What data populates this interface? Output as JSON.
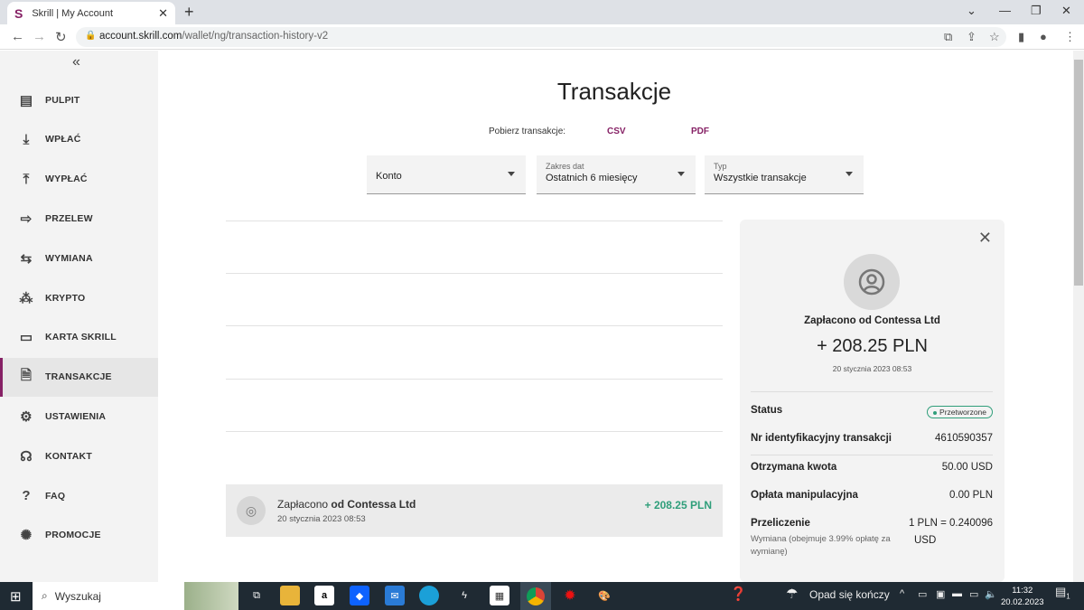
{
  "browser": {
    "tab_title": "Skrill | My Account",
    "tab_logo": "S",
    "url_host": "account.skrill.com",
    "url_path": "/wallet/ng/transaction-history-v2"
  },
  "colors": {
    "brand": "#862165",
    "positive": "#2f9e7a"
  },
  "sidebar": {
    "items": [
      {
        "label": "PULPIT",
        "icon": "dashboard-icon"
      },
      {
        "label": "WPŁAĆ",
        "icon": "deposit-icon"
      },
      {
        "label": "WYPŁAĆ",
        "icon": "withdraw-icon"
      },
      {
        "label": "PRZELEW",
        "icon": "transfer-icon"
      },
      {
        "label": "WYMIANA",
        "icon": "exchange-icon"
      },
      {
        "label": "KRYPTO",
        "icon": "crypto-icon"
      },
      {
        "label": "KARTA SKRILL",
        "icon": "card-icon"
      },
      {
        "label": "TRANSAKCJE",
        "icon": "document-icon",
        "active": true
      },
      {
        "label": "USTAWIENIA",
        "icon": "gear-icon"
      },
      {
        "label": "KONTAKT",
        "icon": "headset-icon"
      },
      {
        "label": "FAQ",
        "icon": "question-icon"
      },
      {
        "label": "PROMOCJE",
        "icon": "promo-icon"
      }
    ]
  },
  "main": {
    "title": "Transakcje",
    "download_label": "Pobierz transakcje:",
    "csv": "CSV",
    "pdf": "PDF",
    "filters": [
      {
        "label": "",
        "value": "Konto"
      },
      {
        "label": "Zakres dat",
        "value": "Ostatnich 6 miesięcy"
      },
      {
        "label": "Typ",
        "value": "Wszystkie transakcje"
      }
    ],
    "transaction": {
      "prefix": "Zapłacono ",
      "name": "od Contessa Ltd",
      "date": "20 stycznia 2023 08:53",
      "amount": "+ 208.25 PLN"
    }
  },
  "details": {
    "title": "Zapłacono od Contessa Ltd",
    "amount": "+ 208.25 PLN",
    "date": "20 stycznia 2023 08:53",
    "status_label": "Status",
    "status_value": "Przetworzone",
    "id_label": "Nr identyfikacyjny transakcji",
    "id_value": "4610590357",
    "received_label": "Otrzymana kwota",
    "received_value": "50.00 USD",
    "fee_label": "Opłata manipulacyjna",
    "fee_value": "0.00 PLN",
    "conv_label": "Przeliczenie",
    "conv_value_1": "1 PLN = 0.240096",
    "conv_value_2": "USD",
    "conv_sub": "Wymiana (obejmuje 3.99% opłatę za wymianę)"
  },
  "taskbar": {
    "search": "Wyszukaj",
    "weather": "Opad się kończy",
    "time": "11:32",
    "date": "20.02.2023",
    "notifications": "1"
  }
}
